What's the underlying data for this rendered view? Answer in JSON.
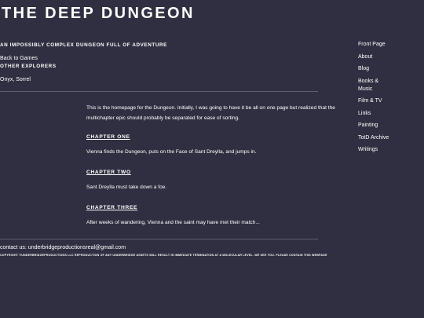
{
  "header": {
    "title": "THE DEEP DUNGEON",
    "tagline": "AN IMPOSSIBLY COMPLEX DUNGEON FULL OF ADVENTURE"
  },
  "left": {
    "back_link": "Back to Games",
    "explorers_heading": "OTHER EXPLORERS",
    "explorers_names": "Onyx, Sorrel"
  },
  "main": {
    "intro": "This is the homepage for the Dungeon. Initially, I was going to have it be all on one page but realized that the multichapter epic should probably be separated for ease of sorting.",
    "chapters": [
      {
        "title": "CHAPTER ONE",
        "summary": "Vienna finds the Dungeon, puts on the Face of Sant Dreylla, and jumps in."
      },
      {
        "title": "CHAPTER TWO",
        "summary": "Sant Dreylla must take down a foe."
      },
      {
        "title": "CHAPTER THREE",
        "summary": "After weeks of wandering, Vienna and the saint may have met their match..."
      }
    ]
  },
  "nav": {
    "items": [
      "Front Page",
      "About",
      "Blog",
      "Books & Music",
      "Film & TV",
      "Links",
      "Painting",
      "TotD Archive",
      "Writings"
    ]
  },
  "footer": {
    "contact": "contact us: underbridgeproductionsreal@gmail.com",
    "copyright": "COPYRIGHT ©UNDERBRIDGEPRODUCTIONS LLC REPRODUCTION OF ANY UNDERBRIDGE ASSETS WILL RESULT IN IMMEDIATE TERMINATION AT A MOLECULAR LEVEL. WE SEE YOU. PLEASE CONTAIN THIS WEBPAGE"
  }
}
